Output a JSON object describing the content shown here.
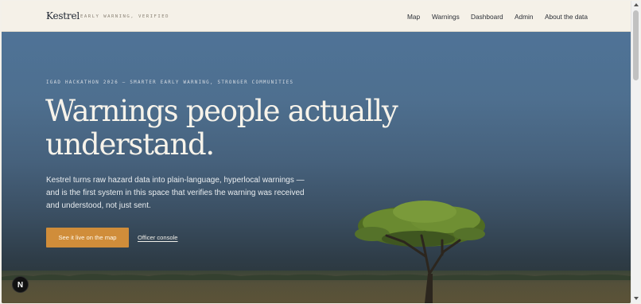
{
  "header": {
    "brand": "Kestrel",
    "tagline": "EARLY WARNING, VERIFIED",
    "nav": {
      "map": "Map",
      "warnings": "Warnings",
      "dashboard": "Dashboard",
      "admin": "Admin",
      "about": "About the data"
    }
  },
  "hero": {
    "kicker": "IGAD HACKATHON 2026 — SMARTER EARLY WARNING, STRONGER COMMUNITIES",
    "headline_line1": "Warnings people actually",
    "headline_line2": "understand.",
    "lede": "Kestrel turns raw hazard data into plain-language, hyperlocal warnings — and is the first system in this space that verifies the warning was received and understood, not just sent.",
    "cta_label": "See it live on the map",
    "console_label": "Officer console"
  },
  "badge": {
    "letter": "N",
    "icon": "dev-badge-icon"
  },
  "colors": {
    "accent": "#d08d3a",
    "sky_top": "#4f7397",
    "header_bg": "#f5f1e8",
    "text_dark": "#1d2430"
  },
  "icons": {
    "tree": "acacia-tree-illustration",
    "scroll_up": "chevron-up-icon",
    "scroll_down": "chevron-down-icon"
  }
}
